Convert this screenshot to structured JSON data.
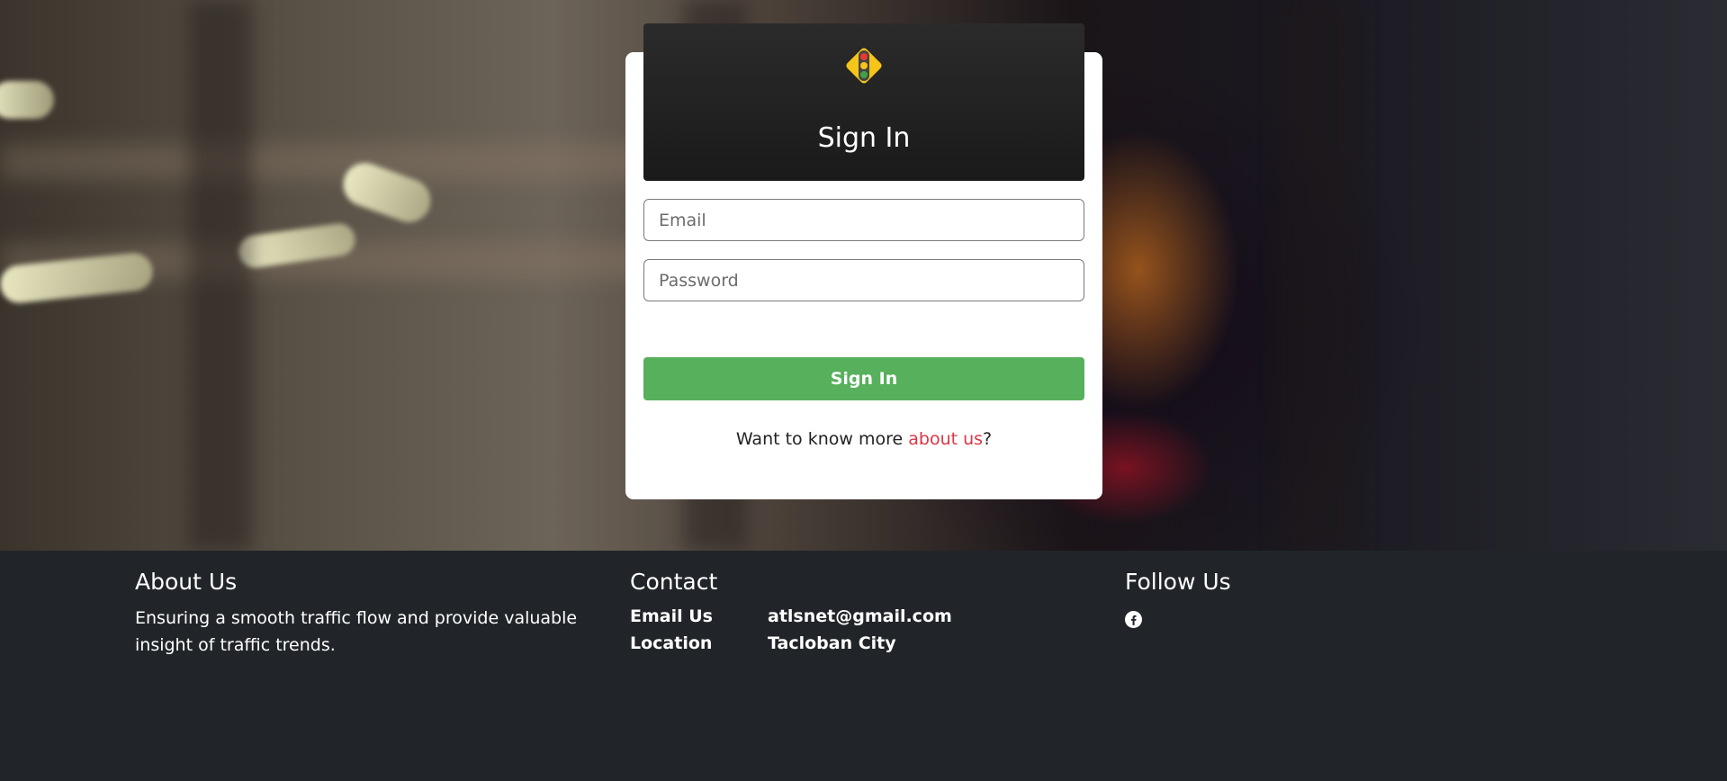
{
  "login": {
    "title": "Sign In",
    "email_placeholder": "Email",
    "password_placeholder": "Password",
    "submit_label": "Sign In",
    "more_prefix": "Want to know more ",
    "more_link": "about us",
    "more_suffix": "?"
  },
  "logo": {
    "icon": "traffic-light-icon",
    "color": "#f5c518"
  },
  "footer": {
    "about": {
      "title": "About Us",
      "text": "Ensuring a smooth traffic flow and provide valuable insight of traffic trends."
    },
    "contact": {
      "title": "Contact",
      "rows": [
        {
          "label": "Email Us",
          "value": "atlsnet@gmail.com"
        },
        {
          "label": "Location",
          "value": "Tacloban City"
        }
      ]
    },
    "follow": {
      "title": "Follow Us",
      "icon": "facebook-icon"
    }
  },
  "colors": {
    "primary_button": "#57b05b",
    "link": "#dc3545",
    "footer_bg": "#212529"
  }
}
